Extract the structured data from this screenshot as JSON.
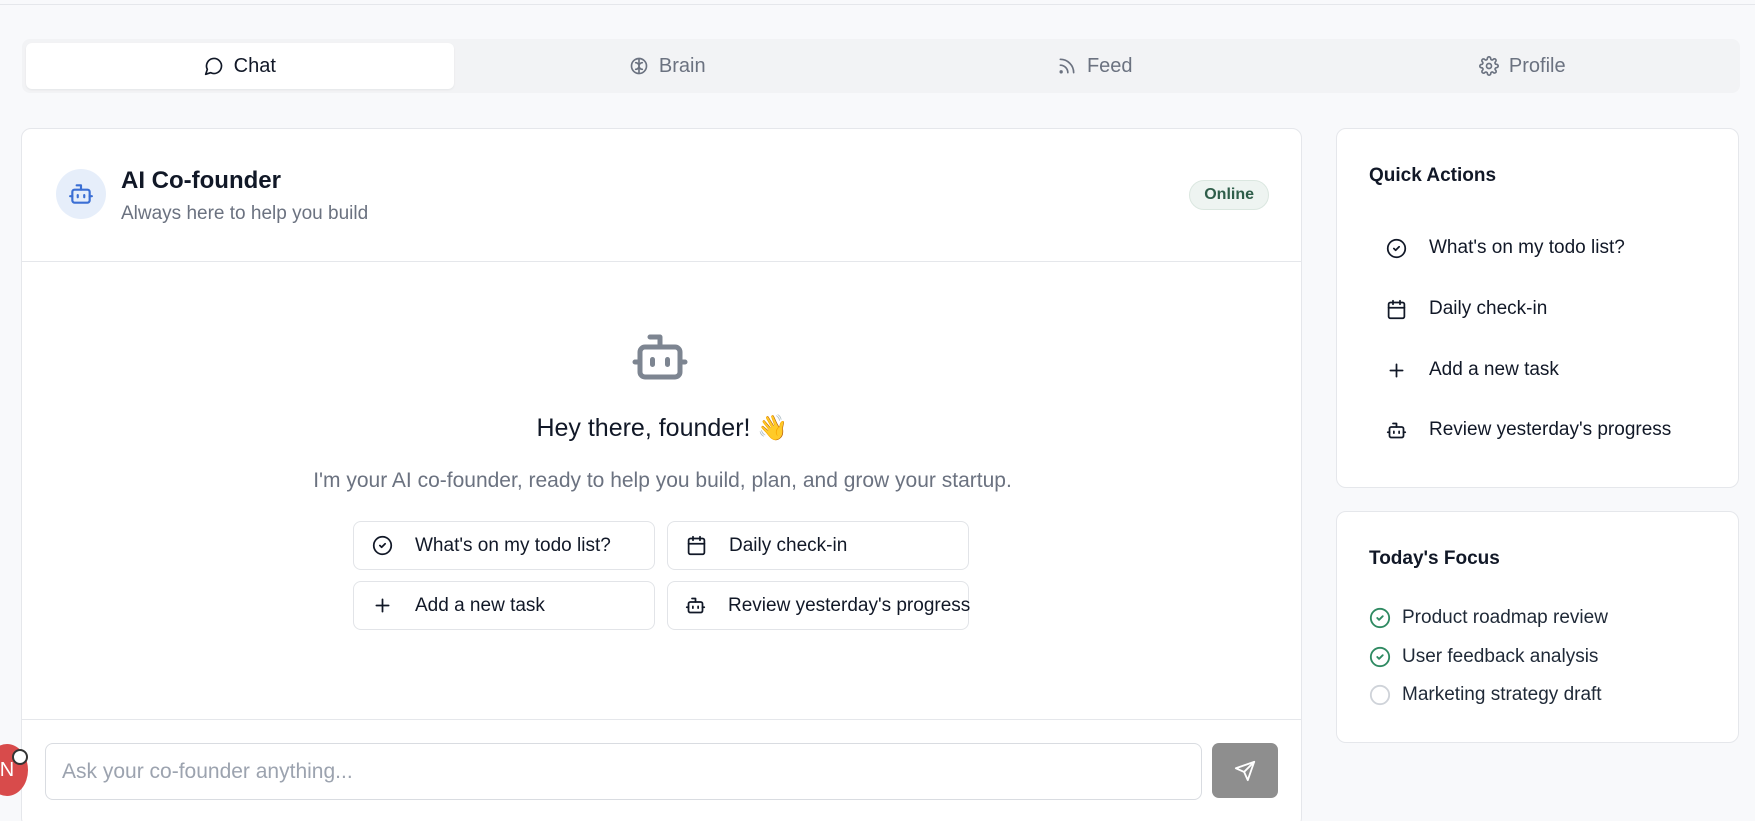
{
  "tabs": [
    {
      "label": "Chat",
      "icon": "chat-bubble-icon",
      "active": true
    },
    {
      "label": "Brain",
      "icon": "brain-icon",
      "active": false
    },
    {
      "label": "Feed",
      "icon": "rss-icon",
      "active": false
    },
    {
      "label": "Profile",
      "icon": "gear-icon",
      "active": false
    }
  ],
  "chat": {
    "title": "AI Co-founder",
    "subtitle": "Always here to help you build",
    "status": "Online",
    "greeting": "Hey there, founder! 👋",
    "intro": "I'm your AI co-founder, ready to help you build, plan, and grow your startup.",
    "suggestions": [
      {
        "label": "What's on my todo list?",
        "icon": "check-circle-icon"
      },
      {
        "label": "Daily check-in",
        "icon": "calendar-icon"
      },
      {
        "label": "Add a new task",
        "icon": "plus-icon"
      },
      {
        "label": "Review yesterday's progress",
        "icon": "bot-icon"
      }
    ],
    "input_placeholder": "Ask your co-founder anything...",
    "input_value": ""
  },
  "quick_actions": {
    "title": "Quick Actions",
    "items": [
      {
        "label": "What's on my todo list?",
        "icon": "check-circle-icon"
      },
      {
        "label": "Daily check-in",
        "icon": "calendar-icon"
      },
      {
        "label": "Add a new task",
        "icon": "plus-icon"
      },
      {
        "label": "Review yesterday's progress",
        "icon": "bot-icon"
      }
    ]
  },
  "todays_focus": {
    "title": "Today's Focus",
    "items": [
      {
        "label": "Product roadmap review",
        "done": true
      },
      {
        "label": "User feedback analysis",
        "done": true
      },
      {
        "label": "Marketing strategy draft",
        "done": false
      }
    ]
  },
  "colors": {
    "accent_done": "#2f8a62",
    "status_bg": "#eef4f1",
    "send_button": "#8e8e8e",
    "avatar_red": "#d84b4b"
  }
}
